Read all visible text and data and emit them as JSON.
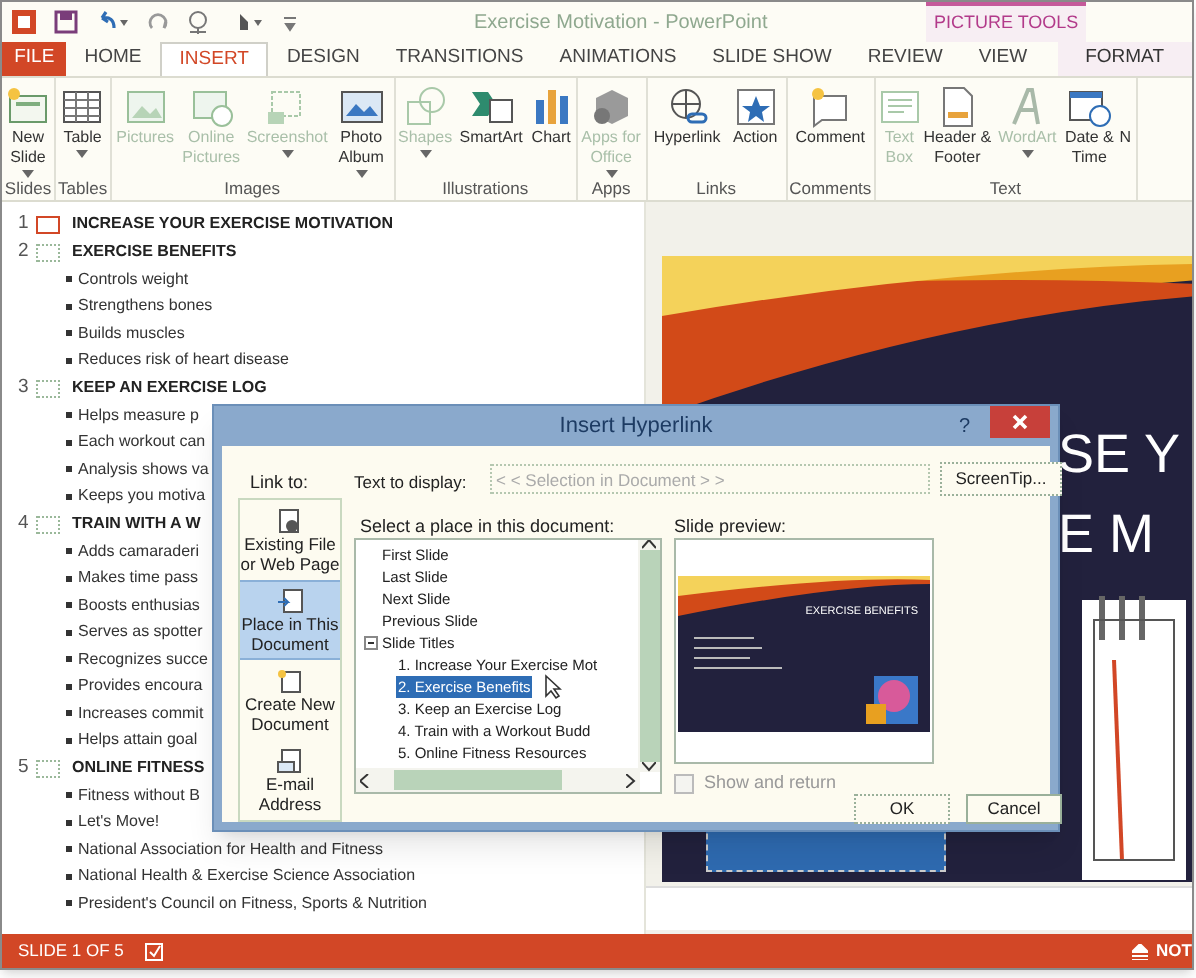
{
  "window": {
    "title": "Exercise Motivation - PowerPoint",
    "contextual_group": "PICTURE TOOLS"
  },
  "ribbon_tabs": [
    {
      "label": "FILE",
      "kind": "file",
      "selected": false
    },
    {
      "label": "HOME",
      "kind": "tab",
      "selected": false
    },
    {
      "label": "INSERT",
      "kind": "tab",
      "selected": true
    },
    {
      "label": "DESIGN",
      "kind": "tab",
      "selected": false
    },
    {
      "label": "TRANSITIONS",
      "kind": "tab",
      "selected": false
    },
    {
      "label": "ANIMATIONS",
      "kind": "tab",
      "selected": false
    },
    {
      "label": "SLIDE SHOW",
      "kind": "tab",
      "selected": false
    },
    {
      "label": "REVIEW",
      "kind": "tab",
      "selected": false
    },
    {
      "label": "VIEW",
      "kind": "tab",
      "selected": false
    },
    {
      "label": "FORMAT",
      "kind": "contextual",
      "selected": false
    }
  ],
  "ribbon_groups": [
    {
      "label": "Slides",
      "buttons": [
        {
          "label": "New Slide",
          "dropdown": true,
          "disabled": false
        }
      ]
    },
    {
      "label": "Tables",
      "buttons": [
        {
          "label": "Table",
          "dropdown": true,
          "disabled": false
        }
      ]
    },
    {
      "label": "Images",
      "buttons": [
        {
          "label": "Pictures",
          "dropdown": false,
          "disabled": true
        },
        {
          "label": "Online Pictures",
          "dropdown": false,
          "disabled": true
        },
        {
          "label": "Screenshot",
          "dropdown": true,
          "disabled": true
        },
        {
          "label": "Photo Album",
          "dropdown": true,
          "disabled": false
        }
      ]
    },
    {
      "label": "Illustrations",
      "buttons": [
        {
          "label": "Shapes",
          "dropdown": true,
          "disabled": true
        },
        {
          "label": "SmartArt",
          "dropdown": false,
          "disabled": false
        },
        {
          "label": "Chart",
          "dropdown": false,
          "disabled": false
        }
      ]
    },
    {
      "label": "Apps",
      "buttons": [
        {
          "label": "Apps for Office",
          "dropdown": true,
          "disabled": true
        }
      ]
    },
    {
      "label": "Links",
      "buttons": [
        {
          "label": "Hyperlink",
          "dropdown": false,
          "disabled": false
        },
        {
          "label": "Action",
          "dropdown": false,
          "disabled": false
        }
      ]
    },
    {
      "label": "Comments",
      "buttons": [
        {
          "label": "Comment",
          "dropdown": false,
          "disabled": false
        }
      ]
    },
    {
      "label": "Text",
      "buttons": [
        {
          "label": "Text Box",
          "dropdown": false,
          "disabled": true
        },
        {
          "label": "Header & Footer",
          "dropdown": false,
          "disabled": false
        },
        {
          "label": "WordArt",
          "dropdown": true,
          "disabled": true
        },
        {
          "label": "Date & Time",
          "dropdown": false,
          "disabled": false
        },
        {
          "label": "N",
          "dropdown": false,
          "disabled": false
        }
      ]
    }
  ],
  "outline": [
    {
      "number": "1",
      "title": "INCREASE YOUR EXERCISE MOTIVATION",
      "selected": true
    },
    {
      "number": "2",
      "title": "EXERCISE BENEFITS",
      "selected": false,
      "bullets": [
        "Controls weight",
        "Strengthens bones",
        "Builds muscles",
        "Reduces risk of heart disease"
      ]
    },
    {
      "number": "3",
      "title": "KEEP AN EXERCISE LOG",
      "selected": false,
      "bullets": [
        "Helps measure p",
        "Each workout can",
        "Analysis shows va",
        "Keeps you motiva"
      ]
    },
    {
      "number": "4",
      "title": "TRAIN WITH A W",
      "selected": false,
      "bullets": [
        "Adds camaraderi",
        "Makes time pass",
        "Boosts enthusias",
        "Serves as spotter",
        "Recognizes succe",
        "Provides encoura",
        "Increases commit",
        "Helps attain goal"
      ]
    },
    {
      "number": "5",
      "title": "ONLINE FITNESS",
      "selected": false,
      "bullets": [
        "Fitness without B",
        "Let's Move!",
        "National Association for Health and Fitness",
        "National Health & Exercise Science Association",
        "President's Council on Fitness, Sports & Nutrition"
      ]
    }
  ],
  "slide": {
    "title_lines": [
      "SE Y",
      "E M"
    ]
  },
  "dialog": {
    "title": "Insert Hyperlink",
    "help": "?",
    "link_to_label": "Link to:",
    "link_options": [
      {
        "label": "Existing File or Web Page",
        "selected": false
      },
      {
        "label": "Place in This Document",
        "selected": true
      },
      {
        "label": "Create New Document",
        "selected": false
      },
      {
        "label": "E-mail Address",
        "selected": false
      }
    ],
    "text_to_display_label": "Text to display:",
    "text_to_display": "< < Selection in Document > >",
    "screentip_button": "ScreenTip...",
    "place_label": "Select a place in this document:",
    "places": [
      {
        "label": "First Slide",
        "selected": false
      },
      {
        "label": "Last Slide",
        "selected": false
      },
      {
        "label": "Next Slide",
        "selected": false
      },
      {
        "label": "Previous Slide",
        "selected": false
      },
      {
        "label": "Slide Titles",
        "selected": false,
        "expanded": true,
        "children": [
          {
            "label": "1. Increase Your Exercise Mot",
            "selected": false
          },
          {
            "label": "2. Exercise Benefits",
            "selected": true
          },
          {
            "label": "3. Keep an Exercise Log",
            "selected": false
          },
          {
            "label": "4. Train with a Workout Budd",
            "selected": false
          },
          {
            "label": "5. Online Fitness Resources",
            "selected": false
          }
        ]
      }
    ],
    "preview_label": "Slide preview:",
    "preview_title": "EXERCISE BENEFITS",
    "show_and_return": {
      "label": "Show and return",
      "checked": false,
      "disabled": true
    },
    "buttons": [
      "OK",
      "Cancel"
    ]
  },
  "status_bar": {
    "slide_position": "SLIDE 1 OF 5",
    "notes": "NOT"
  }
}
